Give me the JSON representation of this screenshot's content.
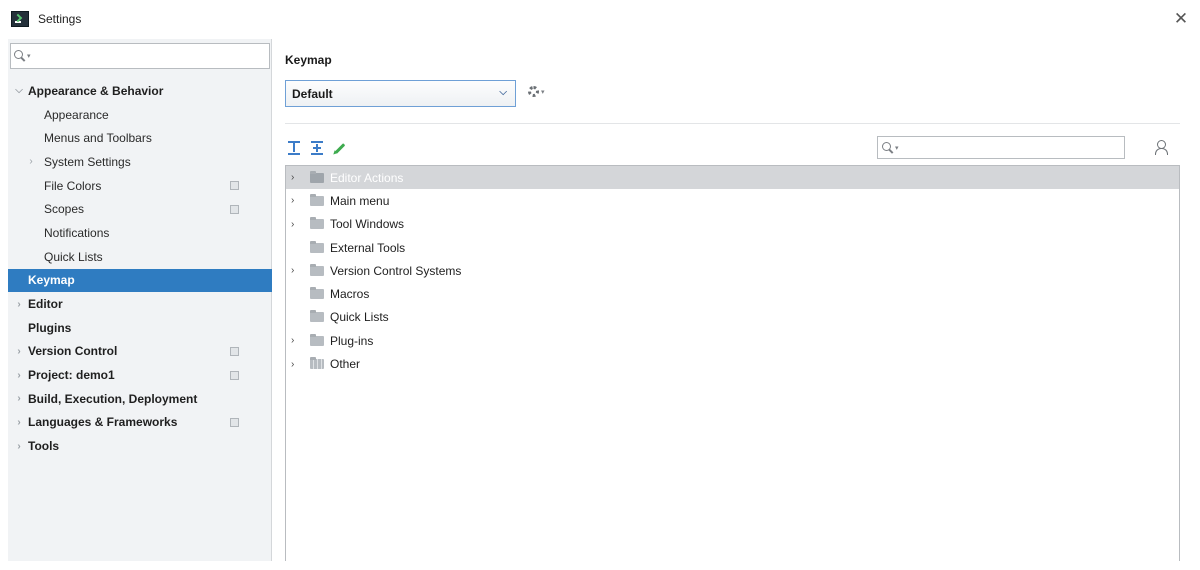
{
  "window": {
    "title": "Settings"
  },
  "sidebar": {
    "search_value": "",
    "items": [
      {
        "label": "Appearance & Behavior",
        "indent": 0,
        "chevron": "expanded",
        "bold": true,
        "badge": false,
        "selected": false
      },
      {
        "label": "Appearance",
        "indent": 1,
        "chevron": "none",
        "bold": false,
        "badge": false,
        "selected": false
      },
      {
        "label": "Menus and Toolbars",
        "indent": 1,
        "chevron": "none",
        "bold": false,
        "badge": false,
        "selected": false
      },
      {
        "label": "System Settings",
        "indent": 1,
        "chevron": "collapsed",
        "bold": false,
        "badge": false,
        "selected": false
      },
      {
        "label": "File Colors",
        "indent": 1,
        "chevron": "none",
        "bold": false,
        "badge": true,
        "selected": false
      },
      {
        "label": "Scopes",
        "indent": 1,
        "chevron": "none",
        "bold": false,
        "badge": true,
        "selected": false
      },
      {
        "label": "Notifications",
        "indent": 1,
        "chevron": "none",
        "bold": false,
        "badge": false,
        "selected": false
      },
      {
        "label": "Quick Lists",
        "indent": 1,
        "chevron": "none",
        "bold": false,
        "badge": false,
        "selected": false
      },
      {
        "label": "Keymap",
        "indent": 0,
        "chevron": "none",
        "bold": true,
        "badge": false,
        "selected": true
      },
      {
        "label": "Editor",
        "indent": 0,
        "chevron": "collapsed",
        "bold": true,
        "badge": false,
        "selected": false
      },
      {
        "label": "Plugins",
        "indent": 0,
        "chevron": "none",
        "bold": true,
        "badge": false,
        "selected": false
      },
      {
        "label": "Version Control",
        "indent": 0,
        "chevron": "collapsed",
        "bold": true,
        "badge": true,
        "selected": false
      },
      {
        "label": "Project: demo1",
        "indent": 0,
        "chevron": "collapsed",
        "bold": true,
        "badge": true,
        "selected": false
      },
      {
        "label": "Build, Execution, Deployment",
        "indent": 0,
        "chevron": "collapsed",
        "bold": true,
        "badge": false,
        "selected": false
      },
      {
        "label": "Languages & Frameworks",
        "indent": 0,
        "chevron": "collapsed",
        "bold": true,
        "badge": true,
        "selected": false
      },
      {
        "label": "Tools",
        "indent": 0,
        "chevron": "collapsed",
        "bold": true,
        "badge": false,
        "selected": false
      }
    ]
  },
  "main": {
    "section_title": "Keymap",
    "keymap_selected": "Default",
    "tree_search_value": "",
    "tree": [
      {
        "label": "Editor Actions",
        "has_children": true,
        "selected": true,
        "folder": "plain"
      },
      {
        "label": "Main menu",
        "has_children": true,
        "selected": false,
        "folder": "plain"
      },
      {
        "label": "Tool Windows",
        "has_children": true,
        "selected": false,
        "folder": "plain"
      },
      {
        "label": "External Tools",
        "has_children": false,
        "selected": false,
        "folder": "plain"
      },
      {
        "label": "Version Control Systems",
        "has_children": true,
        "selected": false,
        "folder": "plain"
      },
      {
        "label": "Macros",
        "has_children": false,
        "selected": false,
        "folder": "plain"
      },
      {
        "label": "Quick Lists",
        "has_children": false,
        "selected": false,
        "folder": "plain"
      },
      {
        "label": "Plug-ins",
        "has_children": true,
        "selected": false,
        "folder": "plain"
      },
      {
        "label": "Other",
        "has_children": true,
        "selected": false,
        "folder": "grid"
      }
    ]
  },
  "icons": {
    "close": "close-icon",
    "search": "search-icon",
    "gear": "gear-icon",
    "expand_all": "expand-all-icon",
    "collapse_all": "collapse-all-icon",
    "edit": "pencil-icon",
    "find_shortcut": "find-by-shortcut-icon"
  },
  "colors": {
    "selection": "#2f7cc1",
    "sidebar_bg": "#f1f3f5",
    "tree_selection": "#d4d6d9",
    "accent_blue": "#3c7cc8",
    "edit_green": "#3eab4f"
  }
}
